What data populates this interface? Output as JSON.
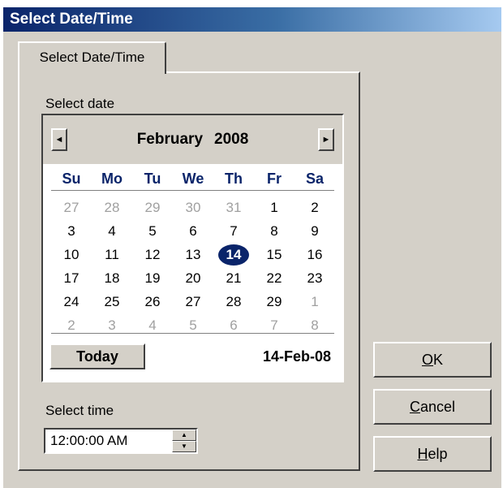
{
  "window": {
    "title": "Select Date/Time"
  },
  "tab": {
    "label": "Select Date/Time"
  },
  "date_section": {
    "label": "Select date"
  },
  "calendar": {
    "month": "February",
    "year": "2008",
    "prev_icon": "triangle-left-icon",
    "next_icon": "triangle-right-icon",
    "weekdays": [
      "Su",
      "Mo",
      "Tu",
      "We",
      "Th",
      "Fr",
      "Sa"
    ],
    "weeks": [
      [
        {
          "d": "27",
          "other": true
        },
        {
          "d": "28",
          "other": true
        },
        {
          "d": "29",
          "other": true
        },
        {
          "d": "30",
          "other": true
        },
        {
          "d": "31",
          "other": true
        },
        {
          "d": "1"
        },
        {
          "d": "2"
        }
      ],
      [
        {
          "d": "3"
        },
        {
          "d": "4"
        },
        {
          "d": "5"
        },
        {
          "d": "6"
        },
        {
          "d": "7"
        },
        {
          "d": "8"
        },
        {
          "d": "9"
        }
      ],
      [
        {
          "d": "10"
        },
        {
          "d": "11"
        },
        {
          "d": "12"
        },
        {
          "d": "13"
        },
        {
          "d": "14",
          "selected": true
        },
        {
          "d": "15"
        },
        {
          "d": "16"
        }
      ],
      [
        {
          "d": "17"
        },
        {
          "d": "18"
        },
        {
          "d": "19"
        },
        {
          "d": "20"
        },
        {
          "d": "21"
        },
        {
          "d": "22"
        },
        {
          "d": "23"
        }
      ],
      [
        {
          "d": "24"
        },
        {
          "d": "25"
        },
        {
          "d": "26"
        },
        {
          "d": "27"
        },
        {
          "d": "28"
        },
        {
          "d": "29"
        },
        {
          "d": "1",
          "other": true
        }
      ],
      [
        {
          "d": "2",
          "other": true
        },
        {
          "d": "3",
          "other": true
        },
        {
          "d": "4",
          "other": true
        },
        {
          "d": "5",
          "other": true
        },
        {
          "d": "6",
          "other": true
        },
        {
          "d": "7",
          "other": true
        },
        {
          "d": "8",
          "other": true
        }
      ]
    ],
    "today_label": "Today",
    "selected_date": "14-Feb-08"
  },
  "time_section": {
    "label": "Select time",
    "value": "12:00:00 AM"
  },
  "buttons": {
    "ok": {
      "mnemonic": "O",
      "rest": "K"
    },
    "cancel": {
      "mnemonic": "C",
      "rest": "ancel"
    },
    "help": {
      "mnemonic": "H",
      "rest": "elp"
    }
  }
}
